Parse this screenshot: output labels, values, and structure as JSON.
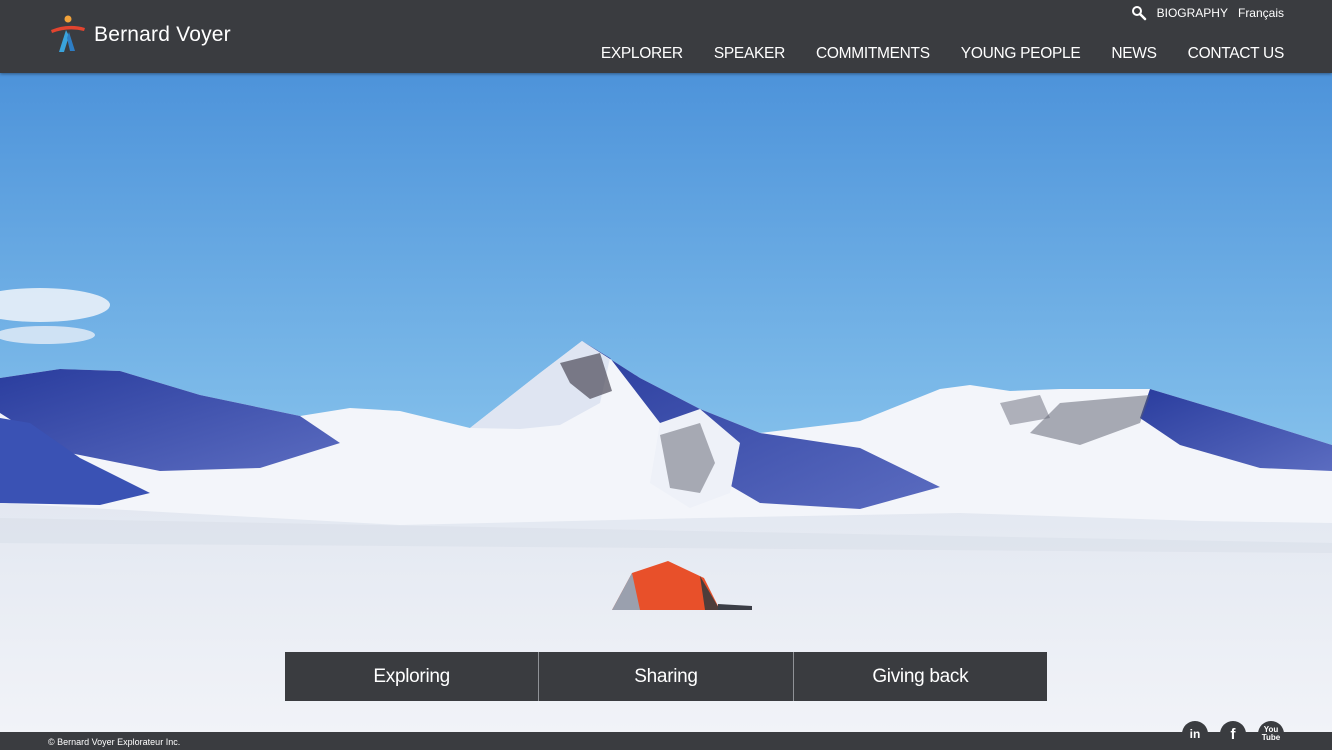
{
  "header": {
    "brand": "Bernard Voyer",
    "utility": {
      "search_icon": "search-icon",
      "biography": "BIOGRAPHY",
      "language": "Français"
    },
    "nav": [
      "EXPLORER",
      "SPEAKER",
      "COMMITMENTS",
      "YOUNG PEOPLE",
      "NEWS",
      "CONTACT US"
    ]
  },
  "hero": {
    "tabs": [
      "Exploring",
      "Sharing",
      "Giving back"
    ]
  },
  "footer": {
    "copyright": "© Bernard Voyer Explorateur Inc.",
    "social": [
      {
        "name": "linkedin-icon",
        "glyph": "in"
      },
      {
        "name": "facebook-icon",
        "glyph": "f"
      },
      {
        "name": "youtube-icon",
        "glyph": "You Tube"
      }
    ]
  },
  "colors": {
    "header_bg": "#3a3c40",
    "sky_top": "#4a90d8",
    "snow": "#eef1f6",
    "tent": "#e8502a"
  }
}
